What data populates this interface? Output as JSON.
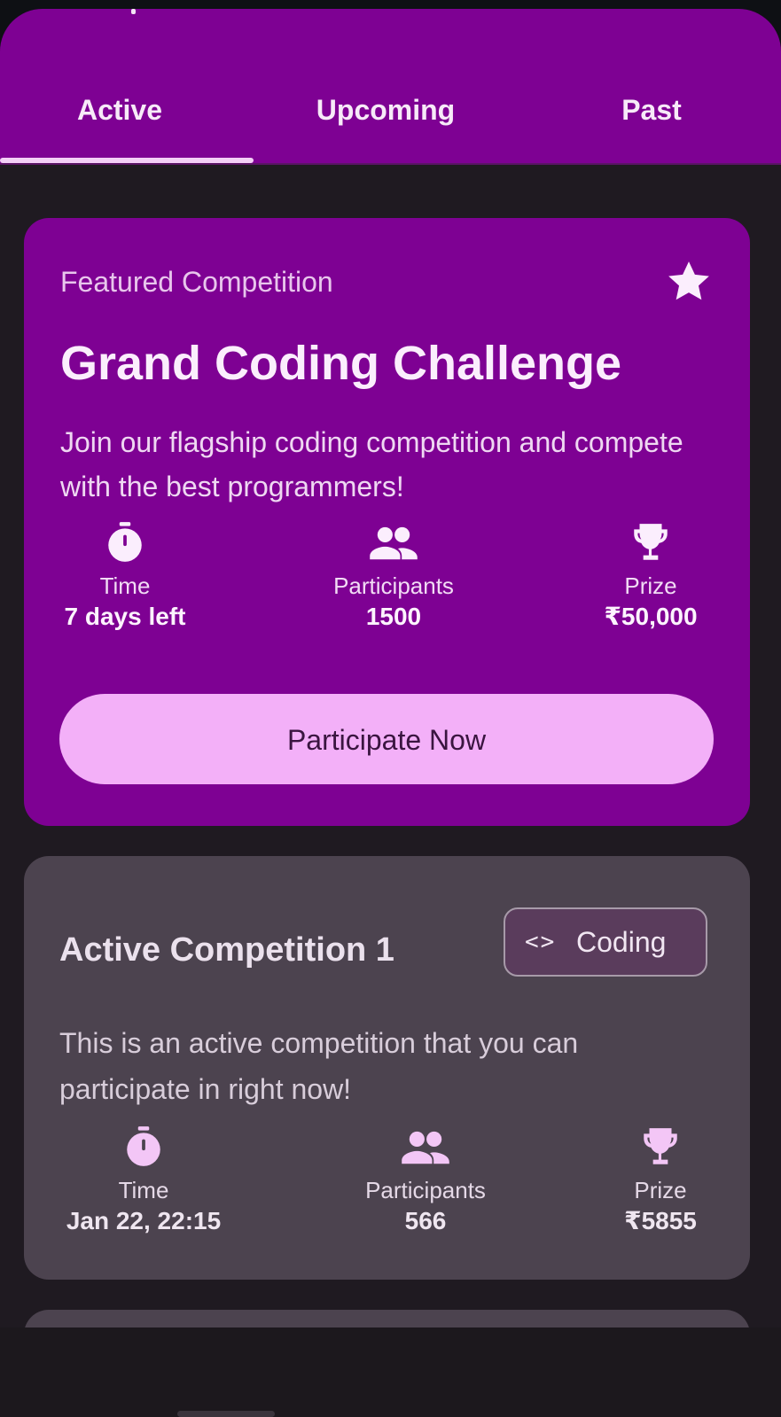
{
  "tabs": [
    {
      "label": "Active",
      "selected": true
    },
    {
      "label": "Upcoming",
      "selected": false
    },
    {
      "label": "Past",
      "selected": false
    }
  ],
  "featured": {
    "label": "Featured Competition",
    "title": "Grand Coding Challenge",
    "description": "Join our flagship coding competition and compete with the best programmers!",
    "icon": "star-icon",
    "stats": {
      "time": {
        "label": "Time",
        "value": "7 days left",
        "icon": "timer-icon"
      },
      "participants": {
        "label": "Participants",
        "value": "1500",
        "icon": "people-icon"
      },
      "prize": {
        "label": "Prize",
        "value": "₹50,000",
        "icon": "trophy-icon"
      }
    },
    "cta_label": "Participate Now"
  },
  "competitions": [
    {
      "title": "Active Competition 1",
      "category": {
        "label": "Coding",
        "icon_glyph": "<>",
        "icon": "code-icon"
      },
      "description": "This is an active competition that you can participate in right now!",
      "stats": {
        "time": {
          "label": "Time",
          "value": "Jan 22, 22:15",
          "icon": "timer-icon"
        },
        "participants": {
          "label": "Participants",
          "value": "566",
          "icon": "people-icon"
        },
        "prize": {
          "label": "Prize",
          "value": "₹5855",
          "icon": "trophy-icon"
        }
      }
    }
  ],
  "colors": {
    "primary": "#7e0193",
    "button": "#f3b0f8",
    "card": "#4c434f",
    "background": "#1f1a21"
  }
}
